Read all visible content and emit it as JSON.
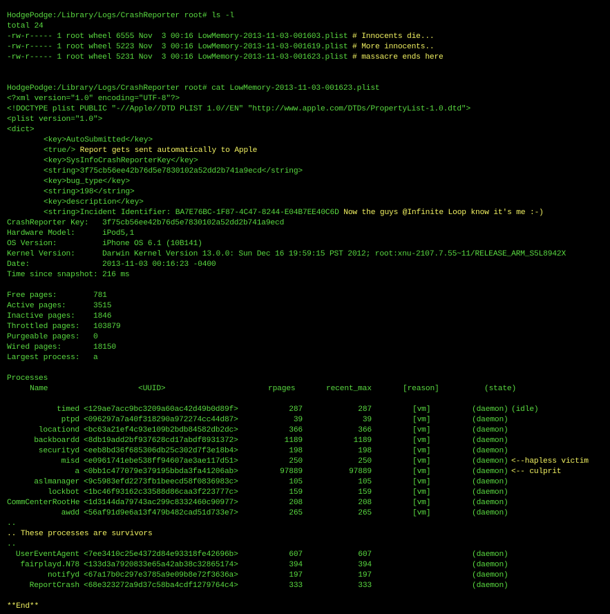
{
  "prompt": "HodgePodge:/Library/Logs/CrashReporter root#",
  "ls_command": " ls -l",
  "ls_total": "total 24",
  "ls_files": [
    {
      "entry": "-rw-r----- 1 root wheel 6555 Nov  3 00:16 LowMemory-2013-11-03-001603.plist",
      "comment": "# Innocents die..."
    },
    {
      "entry": "-rw-r----- 1 root wheel 5223 Nov  3 00:16 LowMemory-2013-11-03-001619.plist",
      "comment": "# More innocents.."
    },
    {
      "entry": "-rw-r----- 1 root wheel 5231 Nov  3 00:16 LowMemory-2013-11-03-001623.plist",
      "comment": "# massacre ends here"
    }
  ],
  "cat_command": " cat LowMemory-2013-11-03-001623.plist",
  "plist_header": [
    "<?xml version=\"1.0\" encoding=\"UTF-8\"?>",
    "<!DOCTYPE plist PUBLIC \"-//Apple//DTD PLIST 1.0//EN\" \"http://www.apple.com/DTDs/PropertyList-1.0.dtd\">",
    "<plist version=\"1.0\">",
    "<dict>"
  ],
  "plist_body": [
    "<key>AutoSubmitted</key>",
    "<true/>",
    "<key>SysInfoCrashReporterKey</key>",
    "<string>3f75cb56ee42b76d5e7830102a52dd2b741a9ecd</string>",
    "<key>bug_type</key>",
    "<string>198</string>",
    "<key>description</key>",
    "<string>Incident Identifier: BA7E76BC-1F87-4C47-8244-E04B7EE40C6D"
  ],
  "plist_comments": {
    "true": " Report gets sent automatically to Apple",
    "incident": " Now the guys @Infinite Loop know it's me :-)"
  },
  "info_fields": [
    {
      "key": "CrashReporter Key:",
      "value": "3f75cb56ee42b76d5e7830102a52dd2b741a9ecd"
    },
    {
      "key": "Hardware Model:",
      "value": "iPod5,1"
    },
    {
      "key": "OS Version:",
      "value": "iPhone OS 6.1 (10B141)"
    },
    {
      "key": "Kernel Version:",
      "value": "Darwin Kernel Version 13.0.0: Sun Dec 16 19:59:15 PST 2012; root:xnu-2107.7.55~11/RELEASE_ARM_S5L8942X"
    },
    {
      "key": "Date:",
      "value": "2013-11-03 00:16:23 -0400"
    },
    {
      "key": "Time since snapshot:",
      "value": "216 ms"
    }
  ],
  "memory_fields": [
    {
      "key": "Free pages:",
      "value": "781"
    },
    {
      "key": "Active pages:",
      "value": "3515"
    },
    {
      "key": "Inactive pages:",
      "value": "1846"
    },
    {
      "key": "Throttled pages:",
      "value": "103879"
    },
    {
      "key": "Purgeable pages:",
      "value": "0"
    },
    {
      "key": "Wired pages:",
      "value": "18150"
    },
    {
      "key": "Largest process:",
      "value": "a"
    }
  ],
  "processes_heading": "Processes",
  "process_columns": {
    "name": "Name",
    "uuid": "<UUID>",
    "rpages": "rpages",
    "recent_max": "recent_max",
    "reason": "[reason]",
    "state": "(state)"
  },
  "processes": [
    {
      "name": "timed",
      "uuid": "<129ae7acc9bc3209a60ac42d49b0d89f>",
      "rpages": "287",
      "recent_max": "287",
      "reason": "[vm]",
      "state": "(daemon)",
      "extra": "(idle)"
    },
    {
      "name": "ptpd",
      "uuid": "<096297a7a40f318290a972274cc44d87>",
      "rpages": "39",
      "recent_max": "39",
      "reason": "[vm]",
      "state": "(daemon)",
      "extra": ""
    },
    {
      "name": "locationd",
      "uuid": "<bc63a21ef4c93e109b2bdb84582db2dc>",
      "rpages": "366",
      "recent_max": "366",
      "reason": "[vm]",
      "state": "(daemon)",
      "extra": ""
    },
    {
      "name": "backboardd",
      "uuid": "<8db19add2bf937628cd17abdf8931372>",
      "rpages": "1189",
      "recent_max": "1189",
      "reason": "[vm]",
      "state": "(daemon)",
      "extra": ""
    },
    {
      "name": "securityd",
      "uuid": "<eeb8bd36f685306db25c302d7f3e18b4>",
      "rpages": "198",
      "recent_max": "198",
      "reason": "[vm]",
      "state": "(daemon)",
      "extra": ""
    },
    {
      "name": "misd",
      "uuid": "<e0961741ebe538ff94607ae3ae117d51>",
      "rpages": "250",
      "recent_max": "250",
      "reason": "[vm]",
      "state": "(daemon)",
      "extra": "<--hapless victim"
    },
    {
      "name": "a",
      "uuid": "<0bb1c477079e379195bbda3fa41206ab>",
      "rpages": "97889",
      "recent_max": "97889",
      "reason": "[vm]",
      "state": "(daemon)",
      "extra": "<-- culprit"
    },
    {
      "name": "aslmanager",
      "uuid": "<9c5983efd2273fb1beecd58f0836983c>",
      "rpages": "105",
      "recent_max": "105",
      "reason": "[vm]",
      "state": "(daemon)",
      "extra": ""
    },
    {
      "name": "lockbot",
      "uuid": "<1bc46f93162c33588d86caa3f223777c>",
      "rpages": "159",
      "recent_max": "159",
      "reason": "[vm]",
      "state": "(daemon)",
      "extra": ""
    },
    {
      "name": "CommCenterRootHe",
      "uuid": "<1d3144da79743ac299c8332460c90977>",
      "rpages": "208",
      "recent_max": "208",
      "reason": "[vm]",
      "state": "(daemon)",
      "extra": ""
    },
    {
      "name": "awdd",
      "uuid": "<56af91d9e6a13f479b482cad51d733e7>",
      "rpages": "265",
      "recent_max": "265",
      "reason": "[vm]",
      "state": "(daemon)",
      "extra": ""
    }
  ],
  "survivors_dots": "..",
  "survivors_note": ".. These processes are survivors",
  "survivors": [
    {
      "name": "UserEventAgent",
      "uuid": "<7ee3410c25e4372d84e93318fe42696b>",
      "rpages": "607",
      "recent_max": "607",
      "state": "(daemon)"
    },
    {
      "name": "fairplayd.N78",
      "uuid": "<133d3a7920833e65a42ab38c32865174>",
      "rpages": "394",
      "recent_max": "394",
      "state": "(daemon)"
    },
    {
      "name": "notifyd",
      "uuid": "<67a17b0c297e3785a9e09b8e72f3636a>",
      "rpages": "197",
      "recent_max": "197",
      "state": "(daemon)"
    },
    {
      "name": "ReportCrash",
      "uuid": "<68e323272a9d37c58ba4cdf1279764c4>",
      "rpages": "333",
      "recent_max": "333",
      "state": "(daemon)"
    }
  ],
  "end_marker": "**End**",
  "colors": {
    "background": "#000000",
    "text_green": "#59d940",
    "text_yellow": "#f0f061"
  }
}
